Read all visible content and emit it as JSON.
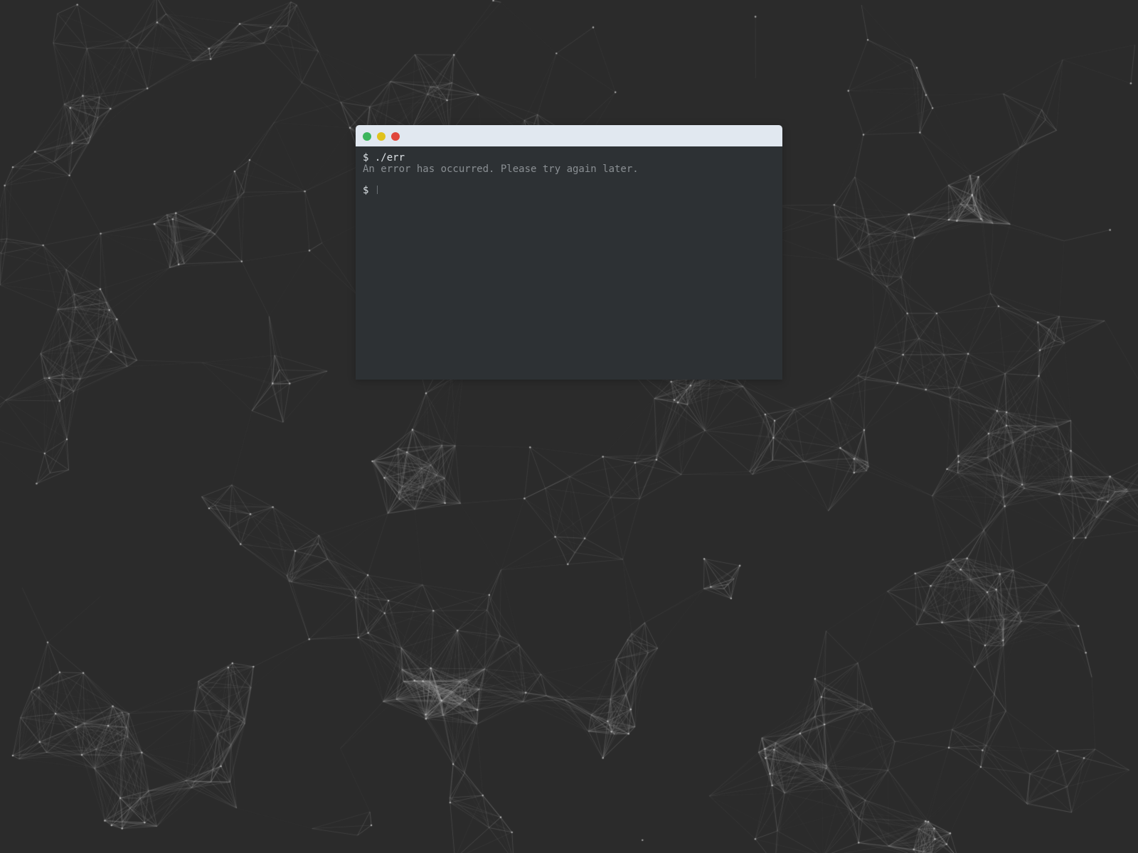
{
  "background": {
    "color": "#2b2b2b",
    "network_line_color": "#9a9a9a",
    "network_node_color": "#cfcfcf"
  },
  "terminal": {
    "titlebar_color": "#e1e8f0",
    "body_color": "#2d3134",
    "buttons": [
      {
        "name": "green-button",
        "color": "#3bb55c"
      },
      {
        "name": "yellow-button",
        "color": "#e0c21c"
      },
      {
        "name": "red-button",
        "color": "#e0463c"
      }
    ],
    "lines": [
      {
        "prompt": "$",
        "command": "./err"
      },
      {
        "output": "An error has occurred. Please try again later."
      }
    ],
    "input_prompt": "$"
  }
}
